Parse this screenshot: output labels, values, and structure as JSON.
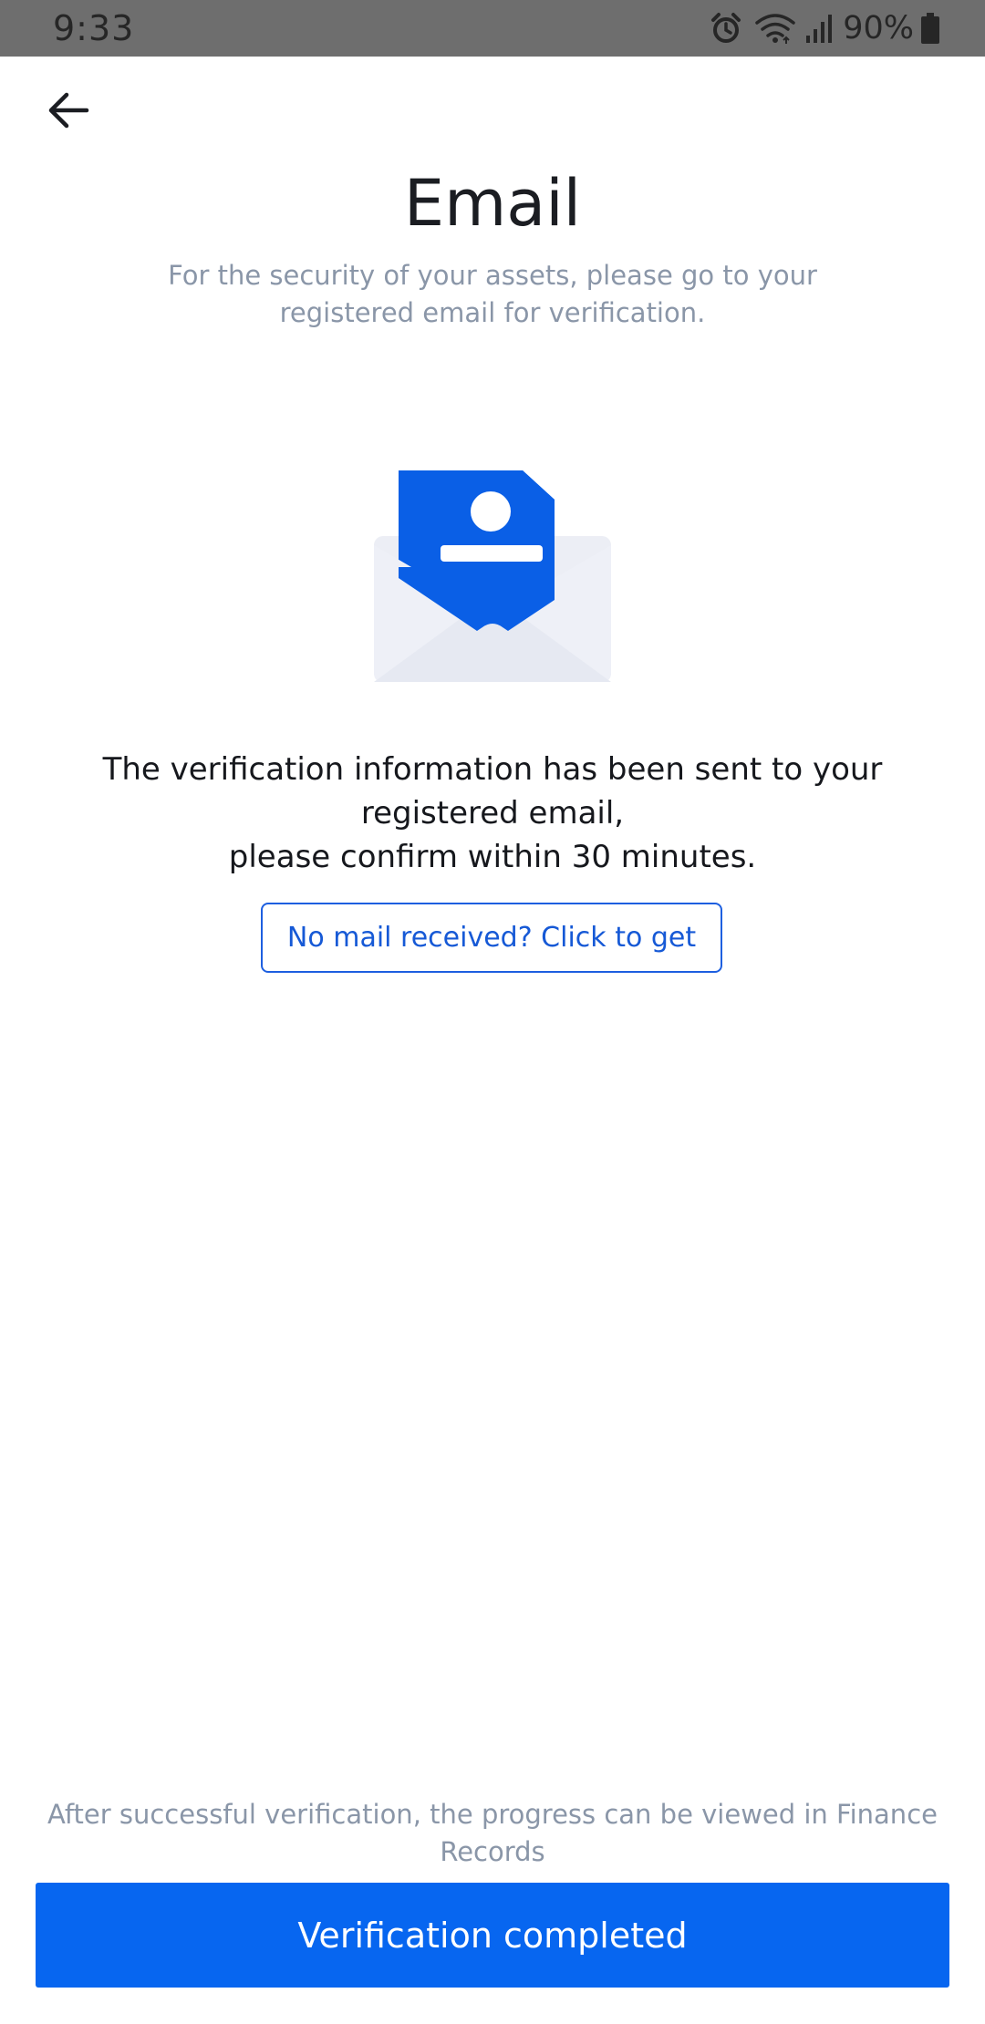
{
  "status_bar": {
    "time": "9:33",
    "battery": "90%",
    "icons": [
      "alarm-icon",
      "wifi-icon",
      "signal-icon",
      "battery-icon"
    ]
  },
  "header": {
    "back_icon": "arrow-left-icon",
    "title": "Email",
    "subtitle": "For the security of your assets, please go to your registered email for verification."
  },
  "illustration": {
    "icon": "open-envelope-with-profile-card-icon"
  },
  "main": {
    "message_line1": "The verification information has been sent to your",
    "message_line2": "registered email,",
    "message_line3": "please confirm within 30 minutes.",
    "resend_label": "No mail received? Click to get"
  },
  "footer": {
    "note": "After successful verification, the progress can be viewed in Finance Records",
    "primary_label": "Verification completed"
  },
  "colors": {
    "accent": "#0766f0",
    "link": "#1659d6",
    "muted_text": "#8a96a8",
    "status_bar_bg": "#6e6e6e",
    "envelope_body": "#eceef5"
  }
}
